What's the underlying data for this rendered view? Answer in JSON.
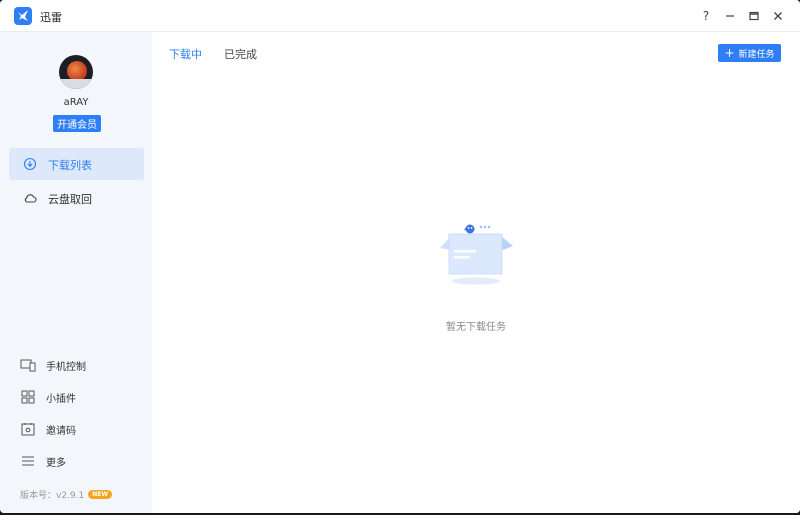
{
  "app": {
    "title": "迅雷"
  },
  "window_controls": {
    "help": "?",
    "minimize": "—",
    "maximize": "▭",
    "close": "✕"
  },
  "user": {
    "name": "aRAY",
    "vip_button": "开通会员"
  },
  "sidebar": {
    "nav": [
      {
        "label": "下载列表",
        "icon": "download-circle-icon",
        "active": true
      },
      {
        "label": "云盘取回",
        "icon": "cloud-icon",
        "active": false
      }
    ],
    "bottom": [
      {
        "label": "手机控制",
        "icon": "devices-icon"
      },
      {
        "label": "小插件",
        "icon": "grid-icon"
      },
      {
        "label": "邀请码",
        "icon": "invite-icon"
      },
      {
        "label": "更多",
        "icon": "menu-icon"
      }
    ],
    "version": "版本号：v2.9.1",
    "version_badge": "NEW"
  },
  "main": {
    "tabs": [
      {
        "label": "下载中",
        "active": true
      },
      {
        "label": "已完成",
        "active": false
      }
    ],
    "new_task_button": "新建任务",
    "empty_text": "暂无下载任务"
  },
  "colors": {
    "accent": "#2e7ff5",
    "sidebar_bg": "#f3f6fa",
    "badge": "#f6a623"
  }
}
